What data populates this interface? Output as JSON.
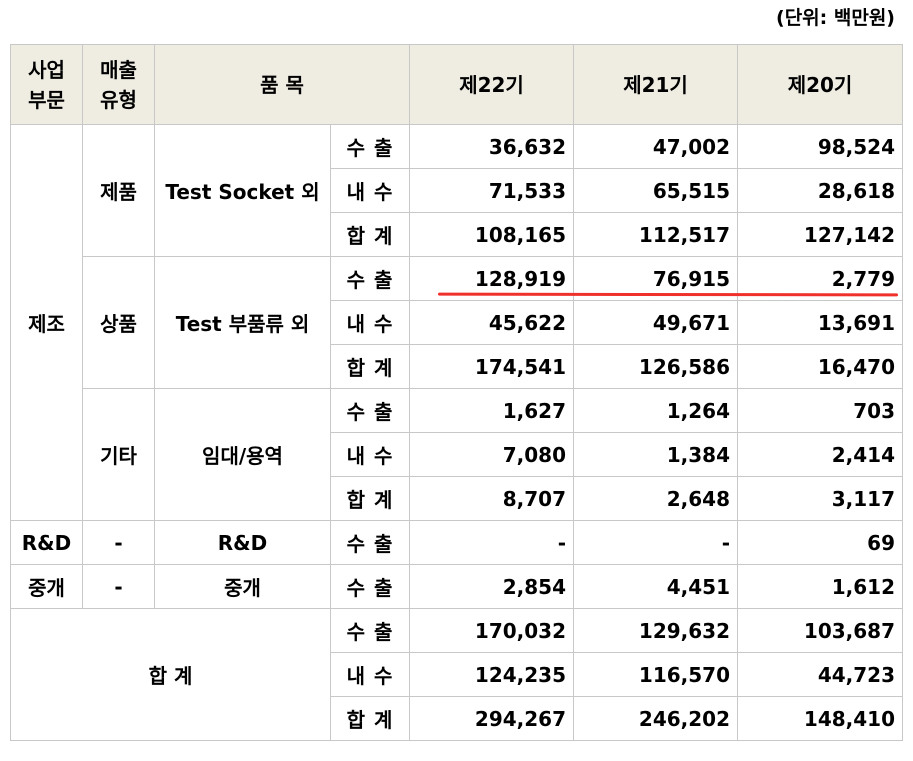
{
  "unit_note": "(단위: 백만원)",
  "header": {
    "segment": [
      "사업",
      "부문"
    ],
    "sales_type": [
      "매출",
      "유형"
    ],
    "item": "품 목",
    "periods": [
      "제22기",
      "제21기",
      "제20기"
    ]
  },
  "groups": {
    "manufacturing": "제조",
    "product": {
      "type": "제품",
      "item": "Test Socket 외"
    },
    "goods": {
      "type": "상품",
      "item": "Test 부품류 외"
    },
    "other": {
      "type": "기타",
      "item": "임대/용역"
    },
    "rnd": {
      "segment": "R&D",
      "type": "-",
      "item": "R&D"
    },
    "brokerage": {
      "segment": "중개",
      "type": "-",
      "item": "중개"
    },
    "total_label": "합 계"
  },
  "rows": [
    {
      "kind": "수 출",
      "values": [
        "36,632",
        "47,002",
        "98,524"
      ]
    },
    {
      "kind": "내 수",
      "values": [
        "71,533",
        "65,515",
        "28,618"
      ]
    },
    {
      "kind": "합 계",
      "values": [
        "108,165",
        "112,517",
        "127,142"
      ]
    },
    {
      "kind": "수 출",
      "values": [
        "128,919",
        "76,915",
        "2,779"
      ]
    },
    {
      "kind": "내 수",
      "values": [
        "45,622",
        "49,671",
        "13,691"
      ]
    },
    {
      "kind": "합 계",
      "values": [
        "174,541",
        "126,586",
        "16,470"
      ]
    },
    {
      "kind": "수 출",
      "values": [
        "1,627",
        "1,264",
        "703"
      ]
    },
    {
      "kind": "내 수",
      "values": [
        "7,080",
        "1,384",
        "2,414"
      ]
    },
    {
      "kind": "합 계",
      "values": [
        "8,707",
        "2,648",
        "3,117"
      ]
    },
    {
      "kind": "수 출",
      "values": [
        "-",
        "-",
        "69"
      ]
    },
    {
      "kind": "수 출",
      "values": [
        "2,854",
        "4,451",
        "1,612"
      ]
    },
    {
      "kind": "수 출",
      "values": [
        "170,032",
        "129,632",
        "103,687"
      ]
    },
    {
      "kind": "내 수",
      "values": [
        "124,235",
        "116,570",
        "44,723"
      ]
    },
    {
      "kind": "합 계",
      "values": [
        "294,267",
        "246,202",
        "148,410"
      ]
    }
  ],
  "annotation": {
    "color": "#f0312b",
    "meaning": "red underline"
  }
}
